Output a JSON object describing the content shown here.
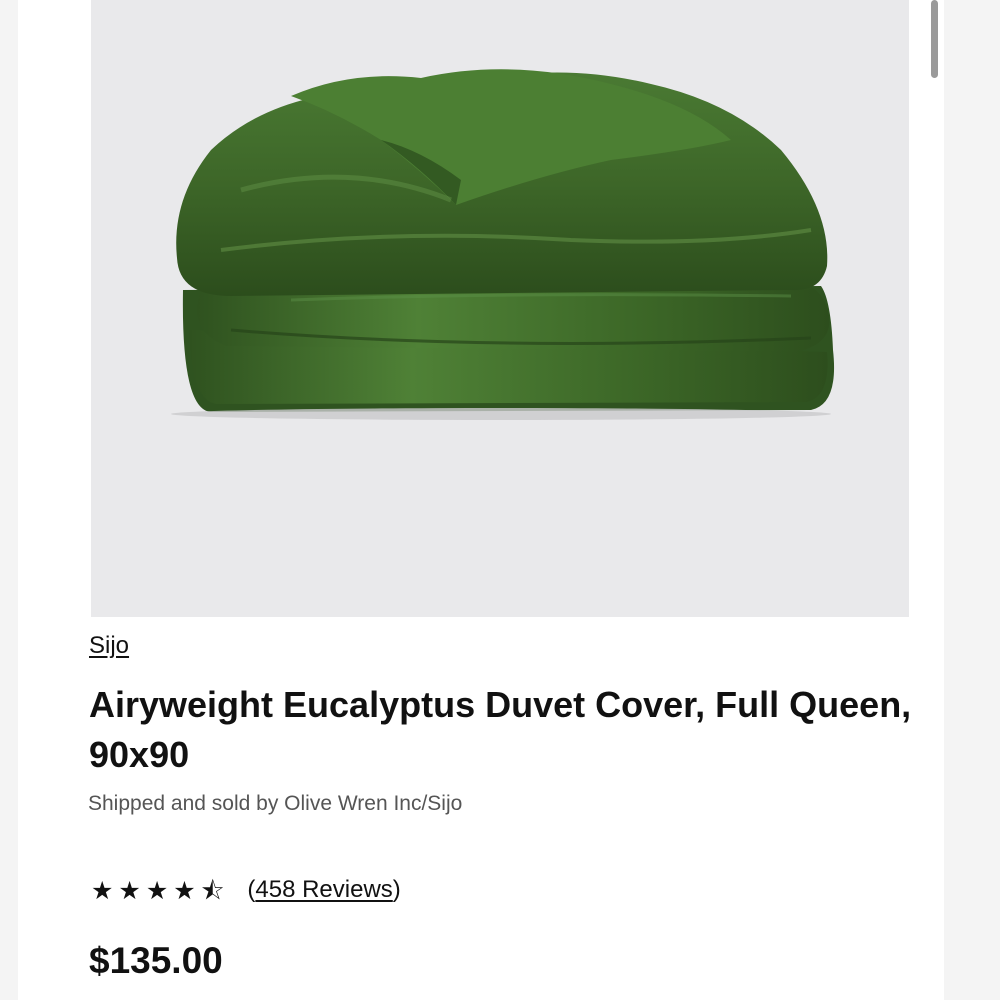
{
  "product": {
    "brand": "Sijo",
    "title": "Airyweight Eucalyptus Duvet Cover, Full Queen, 90x90",
    "seller": "Shipped and sold by Olive Wren Inc/Sijo",
    "rating": {
      "stars_value": 4.5,
      "stars_max": 5,
      "reviews_open": "(",
      "reviews_label": "458 Reviews",
      "reviews_close": ")"
    },
    "price": "$135.00",
    "image_icon": "folded-duvet-image",
    "colors": {
      "duvet": "#3f6a2a",
      "image_bg": "#e9e9eb"
    }
  }
}
